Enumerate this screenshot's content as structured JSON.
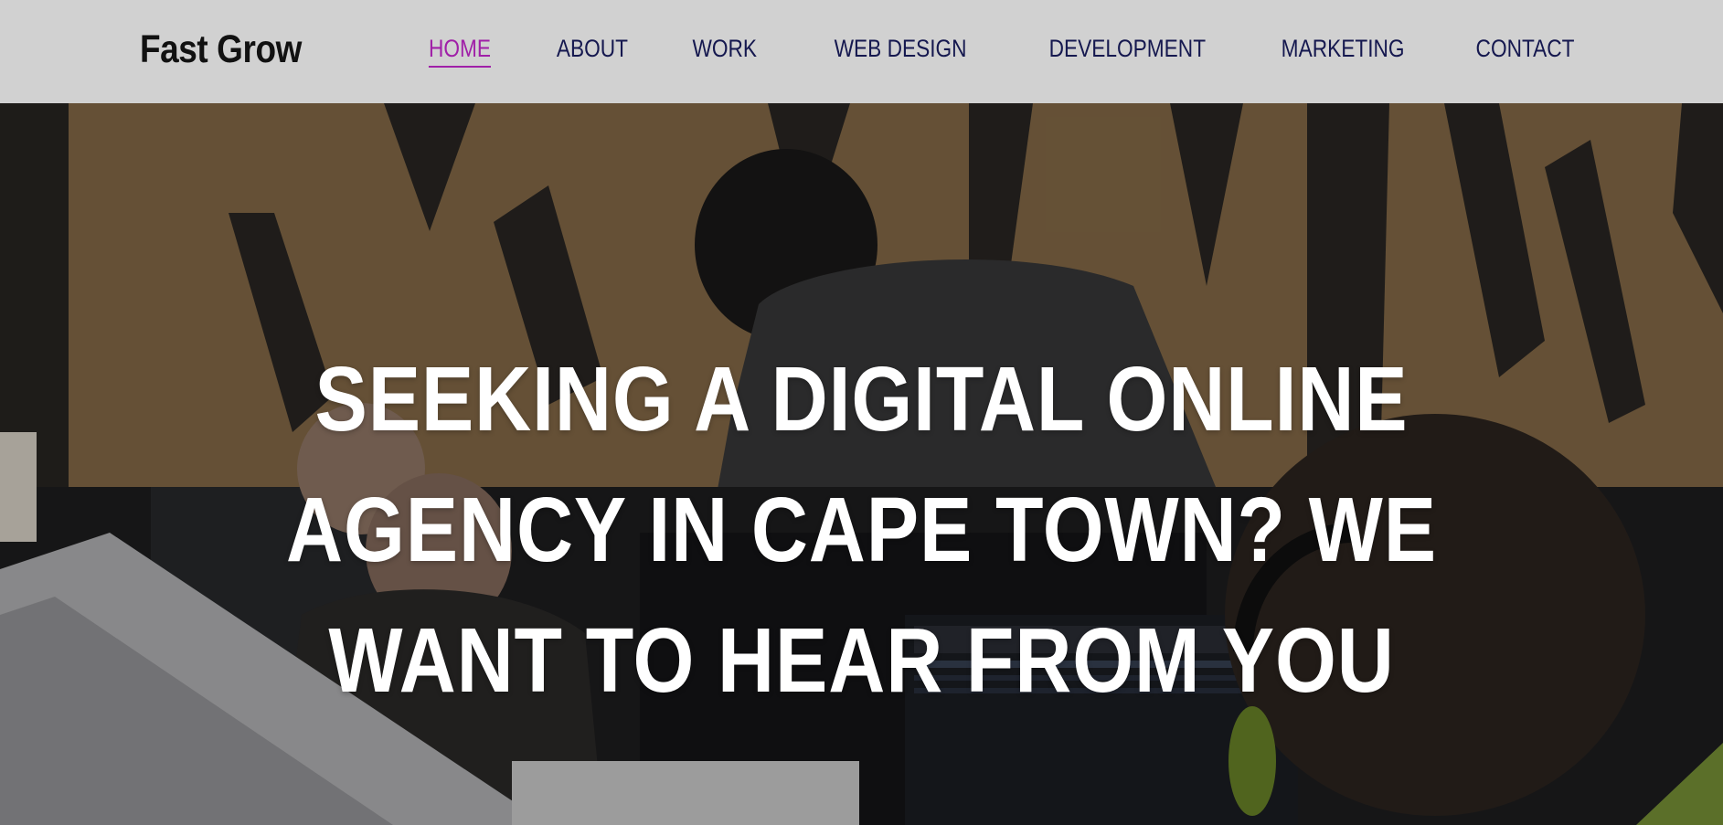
{
  "header": {
    "brand": "Fast Grow",
    "nav": [
      {
        "label": "HOME",
        "active": true
      },
      {
        "label": "ABOUT",
        "active": false
      },
      {
        "label": "WORK",
        "active": false
      },
      {
        "label": "WEB DESIGN",
        "active": false
      },
      {
        "label": "DEVELOPMENT",
        "active": false
      },
      {
        "label": "MARKETING",
        "active": false
      },
      {
        "label": "CONTACT",
        "active": false
      }
    ]
  },
  "hero": {
    "heading": "SEEKING A DIGITAL ONLINE AGENCY IN CAPE TOWN? WE WANT TO HEAR FROM YOU"
  },
  "colors": {
    "header_bg": "#d1d1d1",
    "nav_text": "#15184f",
    "nav_active": "#a020a8",
    "hero_text": "#ffffff"
  }
}
